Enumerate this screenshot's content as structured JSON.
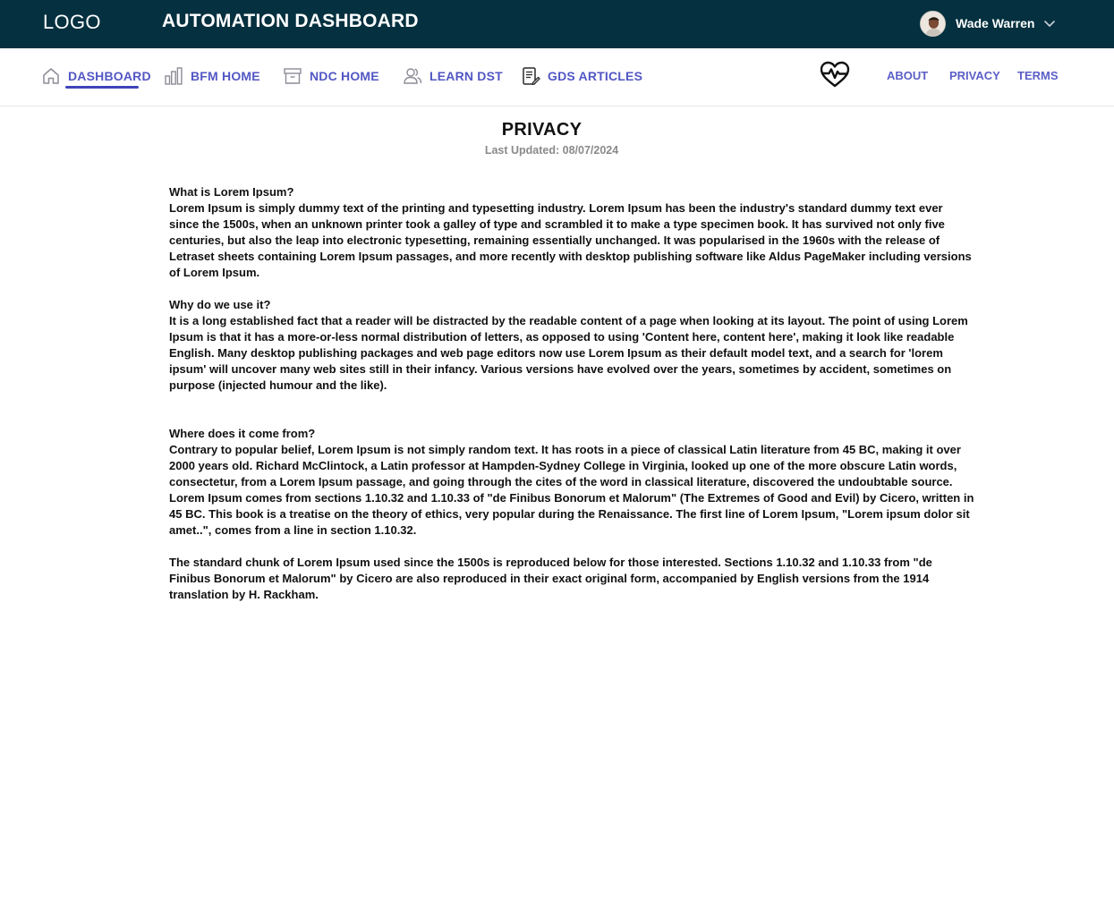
{
  "header": {
    "logo": "LOGO",
    "title": "AUTOMATION DASHBOARD",
    "user": {
      "name": "Wade Warren",
      "avatar_icon": "user-avatar",
      "menu_icon": "chevron-down-icon"
    }
  },
  "nav": {
    "items": [
      {
        "label": "DASHBOARD",
        "icon": "home-icon",
        "active": true
      },
      {
        "label": "BFM HOME",
        "icon": "bar-chart-icon",
        "active": false
      },
      {
        "label": "NDC HOME",
        "icon": "archive-box-icon",
        "active": false
      },
      {
        "label": "LEARN DST",
        "icon": "users-icon",
        "active": false
      },
      {
        "label": "GDS ARTICLES",
        "icon": "document-edit-icon",
        "active": false
      }
    ],
    "health_icon": "heart-pulse-icon",
    "right_links": [
      "ABOUT",
      "PRIVACY",
      "TERMS"
    ]
  },
  "page": {
    "title": "PRIVACY",
    "last_updated": "Last Updated: 08/07/2024",
    "sections": [
      {
        "heading": "What is Lorem Ipsum?",
        "body": "Lorem Ipsum is simply dummy text of the printing and typesetting industry. Lorem Ipsum has been the industry's standard dummy text ever since the 1500s, when an unknown printer took a galley of type and scrambled it to make a type specimen book. It has survived not only five centuries, but also the leap into electronic typesetting, remaining essentially unchanged. It was popularised in the 1960s with the release of Letraset sheets containing Lorem Ipsum passages, and more recently with desktop publishing software like Aldus PageMaker including versions of Lorem Ipsum."
      },
      {
        "heading": "Why do we use it?",
        "body": "It is a long established fact that a reader will be distracted by the readable content of a page when looking at its layout. The point of using Lorem Ipsum is that it has a more-or-less normal distribution of letters, as opposed to using 'Content here, content here', making it look like readable English. Many desktop publishing packages and web page editors now use Lorem Ipsum as their default model text, and a search for 'lorem ipsum' will uncover many web sites still in their infancy. Various versions have evolved over the years, sometimes by accident, sometimes on purpose (injected humour and the like)."
      },
      {
        "heading": "Where does it come from?",
        "body": "Contrary to popular belief, Lorem Ipsum is not simply random text. It has roots in a piece of classical Latin literature from 45 BC, making it over 2000 years old. Richard McClintock, a Latin professor at Hampden-Sydney College in Virginia, looked up one of the more obscure Latin words, consectetur, from a Lorem Ipsum passage, and going through the cites of the word in classical literature, discovered the undoubtable source. Lorem Ipsum comes from sections 1.10.32 and 1.10.33 of \"de Finibus Bonorum et Malorum\" (The Extremes of Good and Evil) by Cicero, written in 45 BC. This book is a treatise on the theory of ethics, very popular during the Renaissance. The first line of Lorem Ipsum, \"Lorem ipsum dolor sit amet..\", comes from a line in section 1.10.32."
      },
      {
        "heading": "",
        "body": "The standard chunk of Lorem Ipsum used since the 1500s is reproduced below for those interested. Sections 1.10.32 and 1.10.33 from \"de Finibus Bonorum et Malorum\" by Cicero are also reproduced in their exact original form, accompanied by English versions from the 1914 translation by H. Rackham."
      }
    ]
  },
  "colors": {
    "header_bg": "#04303f",
    "nav_text": "#5257c4",
    "active_underline": "#3f44b9",
    "muted_text": "#8a8a8a"
  }
}
